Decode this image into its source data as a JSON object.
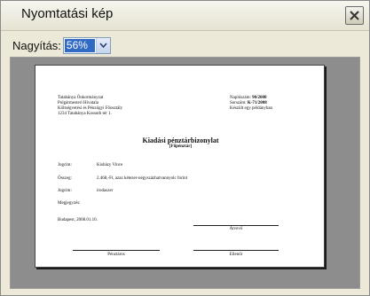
{
  "window": {
    "title": "Nyomtatási kép"
  },
  "zoom": {
    "label": "Nagyítás:",
    "value": "56%"
  },
  "document": {
    "issuer_lines": [
      "Tatabánya Önkormányzat",
      "Polgármesteri Hivatala",
      "Költségvetési és Pénzügyi Főosztály",
      "1234 Tatabánya Kossuth tér 1."
    ],
    "meta_lines": [
      {
        "label": "Naplószám:",
        "value": "90/2008"
      },
      {
        "label": "Sorszám:",
        "value": "K-71/2008"
      },
      {
        "label": "Készült egy példányban",
        "value": ""
      }
    ],
    "title": "Kiadási pénztárbizonylat",
    "subtitle": "[Főpénztár]",
    "fields": [
      {
        "label": "Jogcím:",
        "value": "Kisházy Vince"
      },
      {
        "label": "Összeg:",
        "value": "2.468,-Ft, azaz kétezer-négyszázhatvannyolc forint"
      },
      {
        "label": "Jogcím:",
        "value": "irodaszer"
      },
      {
        "label": "Megjegyzés:",
        "value": ""
      }
    ],
    "place_date": "Budapest, 2008.01.10.",
    "signatures": {
      "receiver": "Átvevő",
      "cashier": "Pénztáros",
      "checker": "Ellenőr"
    }
  }
}
